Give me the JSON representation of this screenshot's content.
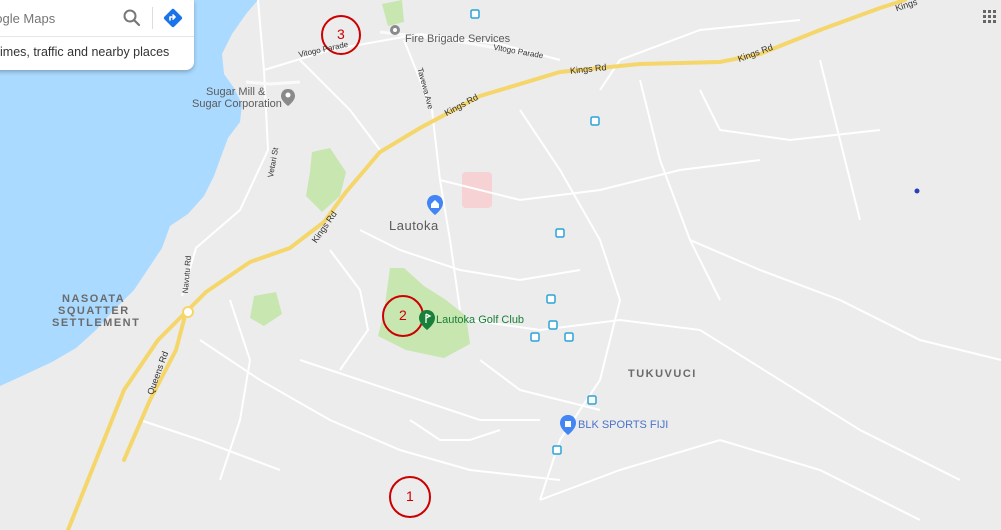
{
  "search": {
    "placeholder": "oogle Maps",
    "subtext": "imes, traffic and nearby places"
  },
  "icons": {
    "search": "search-icon",
    "directions": "directions-icon",
    "apps": "apps-grid-icon",
    "place_pin": "place-pin-icon",
    "bus_stop": "bus-stop-icon",
    "golf": "golf-icon",
    "shopping": "shopping-bag-icon"
  },
  "colors": {
    "water": "#aadaff",
    "land": "#ececec",
    "park": "#c8e6b0",
    "highway": "#f5d66a",
    "road": "#ffffff",
    "marker_circle": "#cc0000",
    "poi_blue": "#4285f4",
    "golf_green": "#188038"
  },
  "labels": {
    "fire_brigade": "Fire Brigade Services",
    "vitogo_parade_1": "Vitogo Parade",
    "vitogo_parade_2": "Vitogo Parade",
    "sugar_mill": "Sugar Mill &",
    "sugar_corp": "Sugar Corporation",
    "tavewa_ave": "Tavewa Ave",
    "kings_rd_1": "Kings Rd",
    "kings_rd_2": "Kings Rd",
    "kings_rd_3": "Kings Rd",
    "kings_rd_4": "Kings Rd",
    "kings_rd_5": "Kings",
    "vetari_st": "Vetari St",
    "lautoka": "Lautoka",
    "navutu_rd": "Navutu Rd",
    "nasoata_1": "NASOATA",
    "nasoata_2": "SQUATTER",
    "nasoata_3": "SETTLEMENT",
    "golf_club": "Lautoka Golf Club",
    "queens_rd": "Queens Rd",
    "tukuvuci": "TUKUVUCI",
    "blk_sports": "BLK SPORTS FIJI"
  },
  "markers": [
    {
      "id": "marker-1",
      "label": "1"
    },
    {
      "id": "marker-2",
      "label": "2"
    },
    {
      "id": "marker-3",
      "label": "3"
    }
  ]
}
